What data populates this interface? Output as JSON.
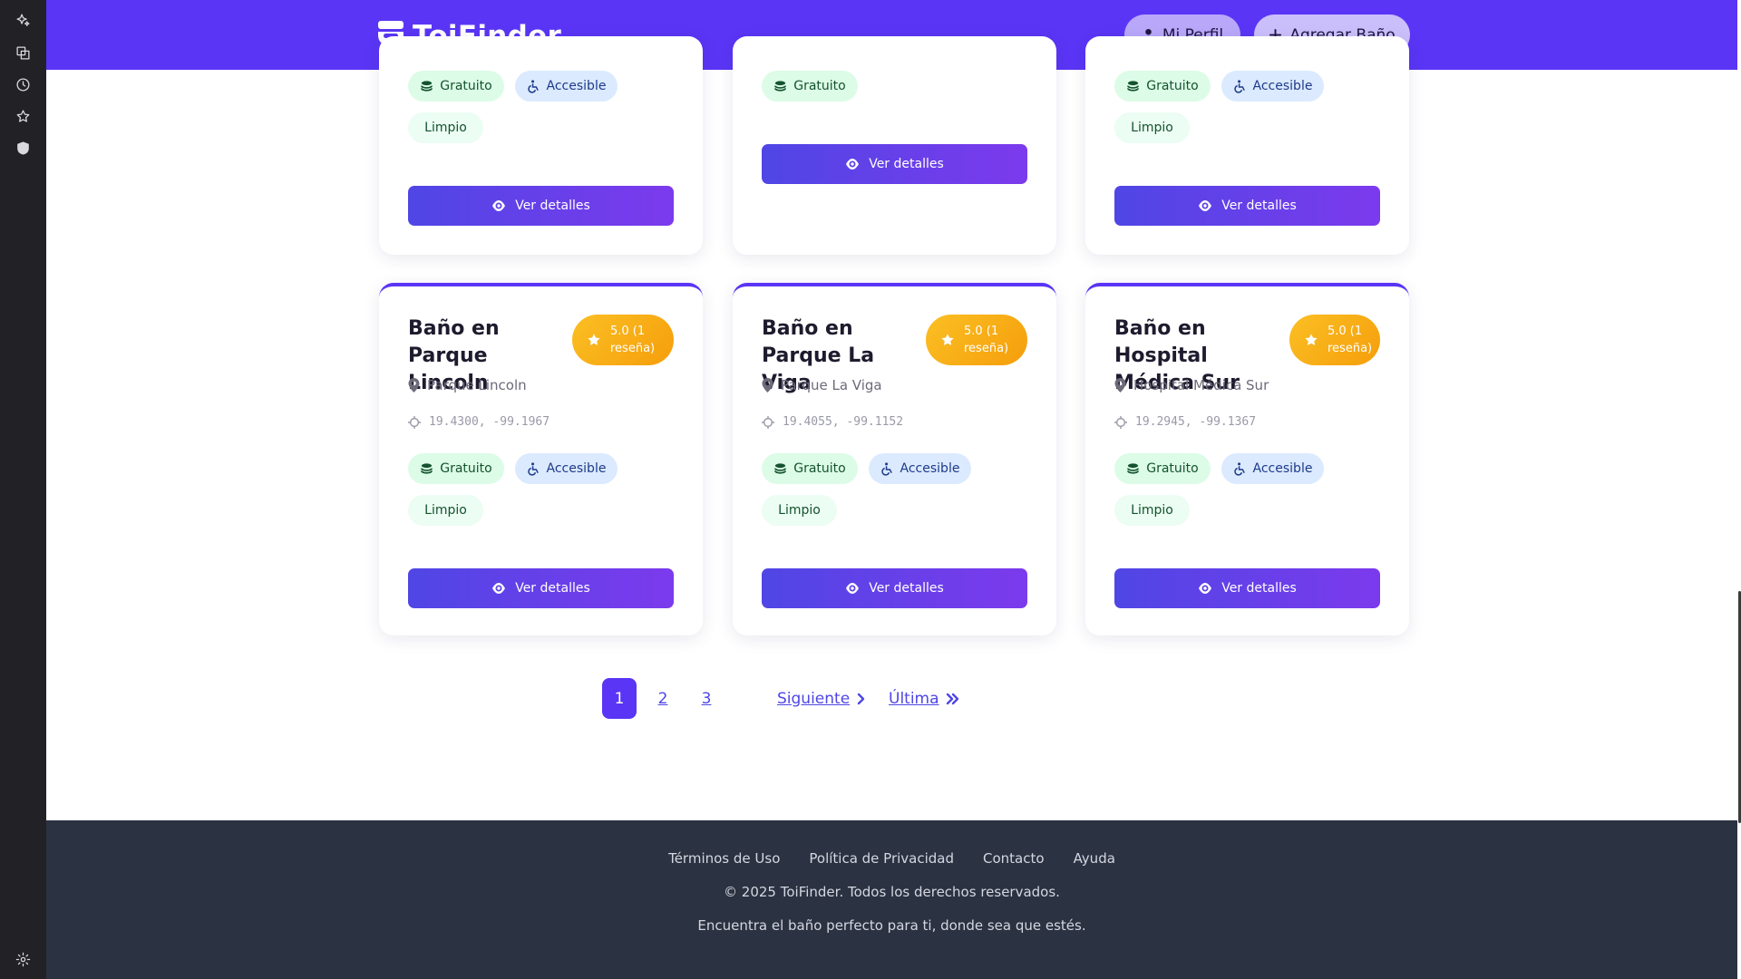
{
  "app": {
    "name": "ToiFinder"
  },
  "header": {
    "profile_label": "Mi Perfil",
    "add_label": "Agregar Baño"
  },
  "tags": {
    "free": "Gratuito",
    "accessible": "Accesible",
    "clean": "Limpio"
  },
  "details_label": "Ver detalles",
  "cards": [
    {
      "title": "Baño en Parque Lincoln",
      "rating": "5.0 (1 reseña)",
      "location": "Parque Lincoln",
      "coords": "19.4300, -99.1967"
    },
    {
      "title": "Baño en Parque La Viga",
      "rating": "5.0 (1 reseña)",
      "location": "Parque La Viga",
      "coords": "19.4055, -99.1152"
    },
    {
      "title": "Baño en Hospital Médica Sur",
      "rating": "5.0 (1 reseña)",
      "location": "Hospital Médica Sur",
      "coords": "19.2945, -99.1367"
    }
  ],
  "pagination": {
    "pages": [
      "1",
      "2",
      "3"
    ],
    "current": "1",
    "next_label": "Siguiente",
    "last_label": "Última"
  },
  "footer": {
    "links": [
      "Términos de Uso",
      "Política de Privacidad",
      "Contacto",
      "Ayuda"
    ],
    "copyright": "© 2025 ToiFinder. Todos los derechos reservados.",
    "tagline": "Encuentra el baño perfecto para ti, donde sea que estés."
  },
  "colors": {
    "brand": "#5a35f5",
    "button_gradient": [
      "#4f46e5",
      "#7c3aed"
    ],
    "rating": "#f59e0b",
    "footer_bg": "#2b3242"
  },
  "icons": {
    "rail": [
      "sparkle-icon",
      "collections-icon",
      "history-icon",
      "star-icon",
      "shield-icon",
      "settings-icon"
    ],
    "card": [
      "star-icon",
      "map-pin-icon",
      "crosshair-icon",
      "coins-icon",
      "wheelchair-icon",
      "eye-icon"
    ]
  }
}
